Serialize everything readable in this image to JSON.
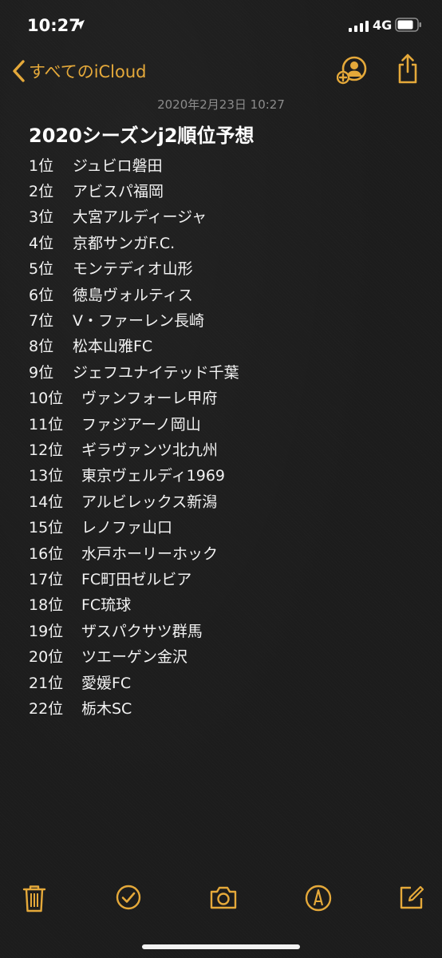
{
  "status_bar": {
    "time": "10:27",
    "network": "4G",
    "icons": [
      "location-arrow-icon",
      "cellular-signal-icon",
      "battery-icon"
    ]
  },
  "nav": {
    "back_label": "すべてのiCloud",
    "accent_color": "#e5a93a",
    "icons": [
      "chevron-left-icon",
      "add-person-icon",
      "share-icon"
    ]
  },
  "note": {
    "timestamp": "2020年2月23日 10:27",
    "title": "2020シーズンj2順位予想",
    "ranks": [
      {
        "pos": "1位",
        "team": "ジュビロ磐田"
      },
      {
        "pos": "2位",
        "team": "アビスパ福岡"
      },
      {
        "pos": "3位",
        "team": "大宮アルディージャ"
      },
      {
        "pos": "4位",
        "team": "京都サンガF.C."
      },
      {
        "pos": "5位",
        "team": "モンテディオ山形"
      },
      {
        "pos": "6位",
        "team": "徳島ヴォルティス"
      },
      {
        "pos": "7位",
        "team": "V・ファーレン長崎"
      },
      {
        "pos": "8位",
        "team": "松本山雅FC"
      },
      {
        "pos": "9位",
        "team": "ジェフユナイテッド千葉"
      },
      {
        "pos": "10位",
        "team": "ヴァンフォーレ甲府"
      },
      {
        "pos": "11位",
        "team": "ファジアーノ岡山"
      },
      {
        "pos": "12位",
        "team": "ギラヴァンツ北九州"
      },
      {
        "pos": "13位",
        "team": "東京ヴェルディ1969"
      },
      {
        "pos": "14位",
        "team": "アルビレックス新潟"
      },
      {
        "pos": "15位",
        "team": "レノファ山口"
      },
      {
        "pos": "16位",
        "team": "水戸ホーリーホック"
      },
      {
        "pos": "17位",
        "team": "FC町田ゼルビア"
      },
      {
        "pos": "18位",
        "team": "FC琉球"
      },
      {
        "pos": "19位",
        "team": "ザスパクサツ群馬"
      },
      {
        "pos": "20位",
        "team": "ツエーゲン金沢"
      },
      {
        "pos": "21位",
        "team": "愛媛FC"
      },
      {
        "pos": "22位",
        "team": "栃木SC"
      }
    ]
  },
  "toolbar": {
    "icons": [
      "trash-icon",
      "checklist-icon",
      "camera-icon",
      "markup-pen-icon",
      "compose-icon"
    ]
  }
}
